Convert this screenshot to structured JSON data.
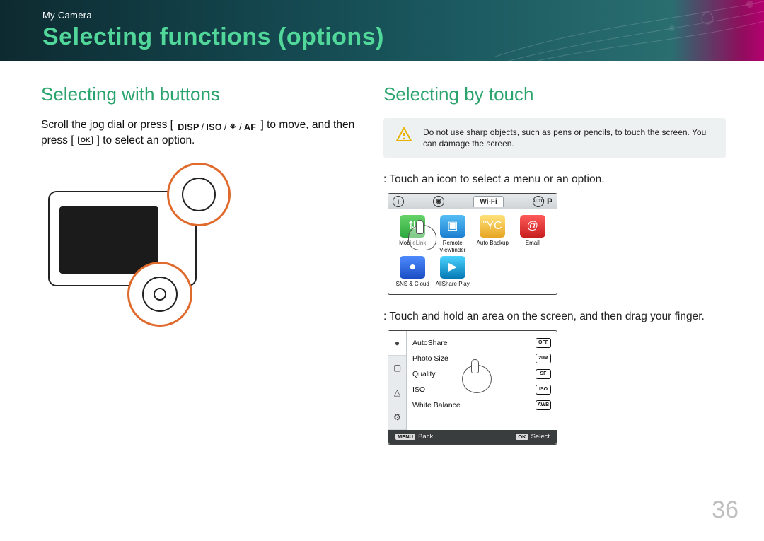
{
  "header": {
    "breadcrumb": "My Camera",
    "title": "Selecting functions (options)"
  },
  "left": {
    "heading": "Selecting with buttons",
    "text_before": "Scroll the jog dial or press [",
    "icons": {
      "disp": "DISP",
      "iso": "ISO",
      "macro": "⚘",
      "af": "AF"
    },
    "text_mid": "] to move, and then press [",
    "ok_icon": "OK",
    "text_after": "] to select an option."
  },
  "right": {
    "heading": "Selecting by touch",
    "warning": "Do not use sharp objects, such as pens or pencils, to touch the screen. You can damage the screen.",
    "touching_label": ": Touch an icon to select a menu or an option.",
    "dragging_label": ": Touch and hold an area on the screen, and then drag your finger.",
    "screen1": {
      "topbar": {
        "info": "i",
        "cam": "◉",
        "wifi": "Wi-Fi",
        "auto": "AUTO",
        "mode": "P"
      },
      "apps": [
        {
          "name": "MobileLink",
          "cls": "green",
          "glyph": "⇅"
        },
        {
          "name": "Remote Viewfinder",
          "cls": "blue",
          "glyph": "▣"
        },
        {
          "name": "Auto Backup",
          "cls": "photo",
          "glyph": "ὛC"
        },
        {
          "name": "Email",
          "cls": "red",
          "glyph": "@"
        },
        {
          "name": "SNS & Cloud",
          "cls": "globe",
          "glyph": "●"
        },
        {
          "name": "AllShare Play",
          "cls": "share",
          "glyph": "▶"
        }
      ]
    },
    "screen2": {
      "tabs_glyphs": [
        "●",
        "▢",
        "△",
        "⚙"
      ],
      "items": [
        {
          "label": "AutoShare",
          "val": "OFF"
        },
        {
          "label": "Photo Size",
          "val": "20M"
        },
        {
          "label": "Quality",
          "val": "SF"
        },
        {
          "label": "ISO",
          "val": "ISO"
        },
        {
          "label": "White Balance",
          "val": "AWB"
        }
      ],
      "footer": {
        "back_key": "MENU",
        "back": "Back",
        "select_key": "OK",
        "select": "Select"
      }
    }
  },
  "page_number": "36"
}
